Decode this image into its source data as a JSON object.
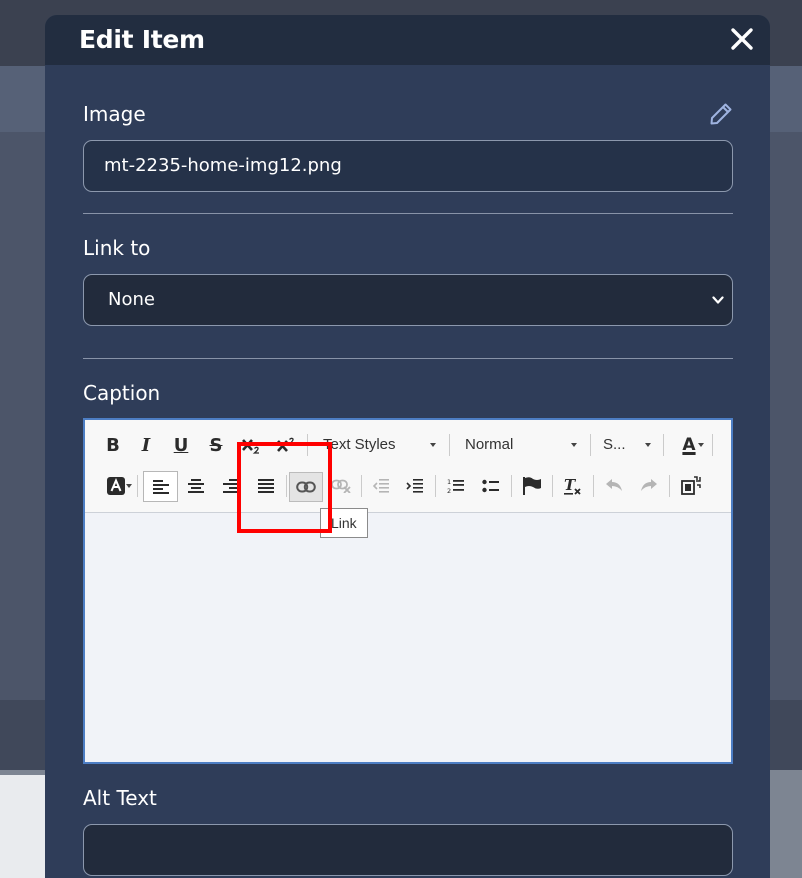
{
  "modal": {
    "title": "Edit Item"
  },
  "image_section": {
    "label": "Image",
    "value": "mt-2235-home-img12.png"
  },
  "link_section": {
    "label": "Link to",
    "selected": "None"
  },
  "caption_section": {
    "label": "Caption",
    "toolbar": {
      "bold": "B",
      "italic": "I",
      "underline": "U",
      "strike": "S",
      "text_styles": "Text Styles",
      "format": "Normal",
      "size": "S...",
      "font_color": "A"
    },
    "tooltip": "Link"
  },
  "alt_section": {
    "label": "Alt Text",
    "value": ""
  },
  "colors": {
    "modal_bg": "#2f3d59",
    "header_bg": "#222d40",
    "highlight": "#ff0000"
  }
}
